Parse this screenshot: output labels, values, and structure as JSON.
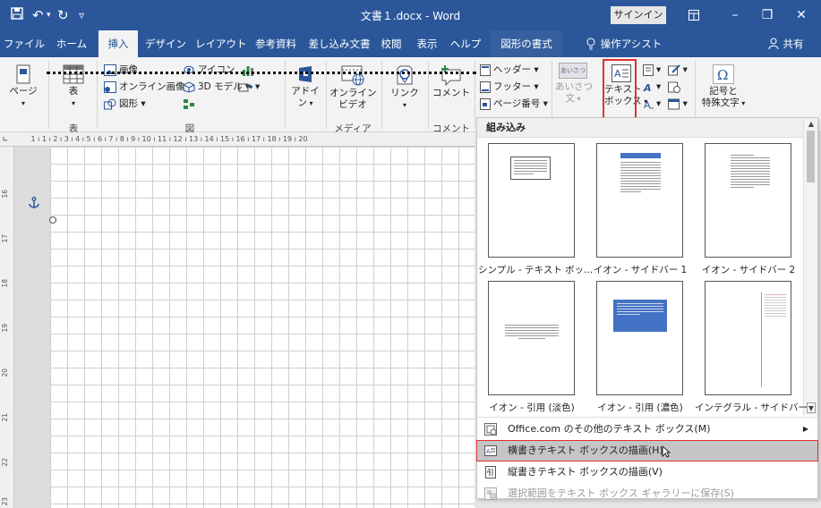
{
  "titlebar": {
    "title": "文書１.docx - Word",
    "signin": "サインイン"
  },
  "tabs": [
    {
      "label": "ファイル"
    },
    {
      "label": "ホーム"
    },
    {
      "label": "挿入"
    },
    {
      "label": "デザイン"
    },
    {
      "label": "レイアウト"
    },
    {
      "label": "参考資料"
    },
    {
      "label": "差し込み文書"
    },
    {
      "label": "校閲"
    },
    {
      "label": "表示"
    },
    {
      "label": "ヘルプ"
    },
    {
      "label": "図形の書式"
    },
    {
      "label": "操作アシスト"
    },
    {
      "label": "共有"
    }
  ],
  "ribbon": {
    "page_label": "ページ",
    "table_label": "表",
    "image": "画像",
    "online_image": "オンライン画像",
    "shape": "図形",
    "icon": "アイコン",
    "model3d": "3D モデル",
    "addin": "アドイ\nン",
    "online_video": "オンライン\nビデオ",
    "link": "リンク",
    "comment": "コメント",
    "header": "ヘッダー",
    "footer": "フッター",
    "page_number": "ページ番号",
    "greeting_1": "あいさつ",
    "greeting_2": "あいさつ\n文",
    "textbox": "テキスト\nボックス",
    "symbol": "記号と\n特殊文字",
    "groups": {
      "table": "表",
      "figure": "図",
      "media": "メディア",
      "comment": "コメント"
    }
  },
  "ruler": {
    "marks": "1 ı 1 ı 2 ı 3 ı 4 ı 5 ı 6 ı 7 ı 8 ı 9 ı 10 ı 11 ı 12 ı 13 ı 14 ı 15 ı 16 ı 17 ı 18 ı 19 ı 20",
    "vmarks": [
      "16",
      "17",
      "18",
      "19",
      "20",
      "21",
      "22",
      "23"
    ]
  },
  "gallery": {
    "header": "組み込み",
    "items": [
      {
        "label": "シンプル - テキスト ボッ..."
      },
      {
        "label": "イオン - サイドバー 1"
      },
      {
        "label": "イオン - サイドバー 2"
      },
      {
        "label": "イオン - 引用 (淡色)"
      },
      {
        "label": "イオン - 引用 (濃色)"
      },
      {
        "label": "インテグラル - サイドバー"
      }
    ],
    "menu": [
      {
        "label": "Office.com のその他のテキスト ボックス(M)",
        "state": "normal"
      },
      {
        "label": "横書きテキスト ボックスの描画(H)",
        "state": "highlighted"
      },
      {
        "label": "縦書きテキスト ボックスの描画(V)",
        "state": "normal"
      },
      {
        "label": "選択範囲をテキスト ボックス ギャラリーに保存(S)",
        "state": "disabled"
      }
    ]
  },
  "colors": {
    "brand": "#2b579a",
    "highlight_border": "#e03030",
    "accent_blue_thumb": "#4472c4",
    "accent_red_line": "#e08080"
  }
}
